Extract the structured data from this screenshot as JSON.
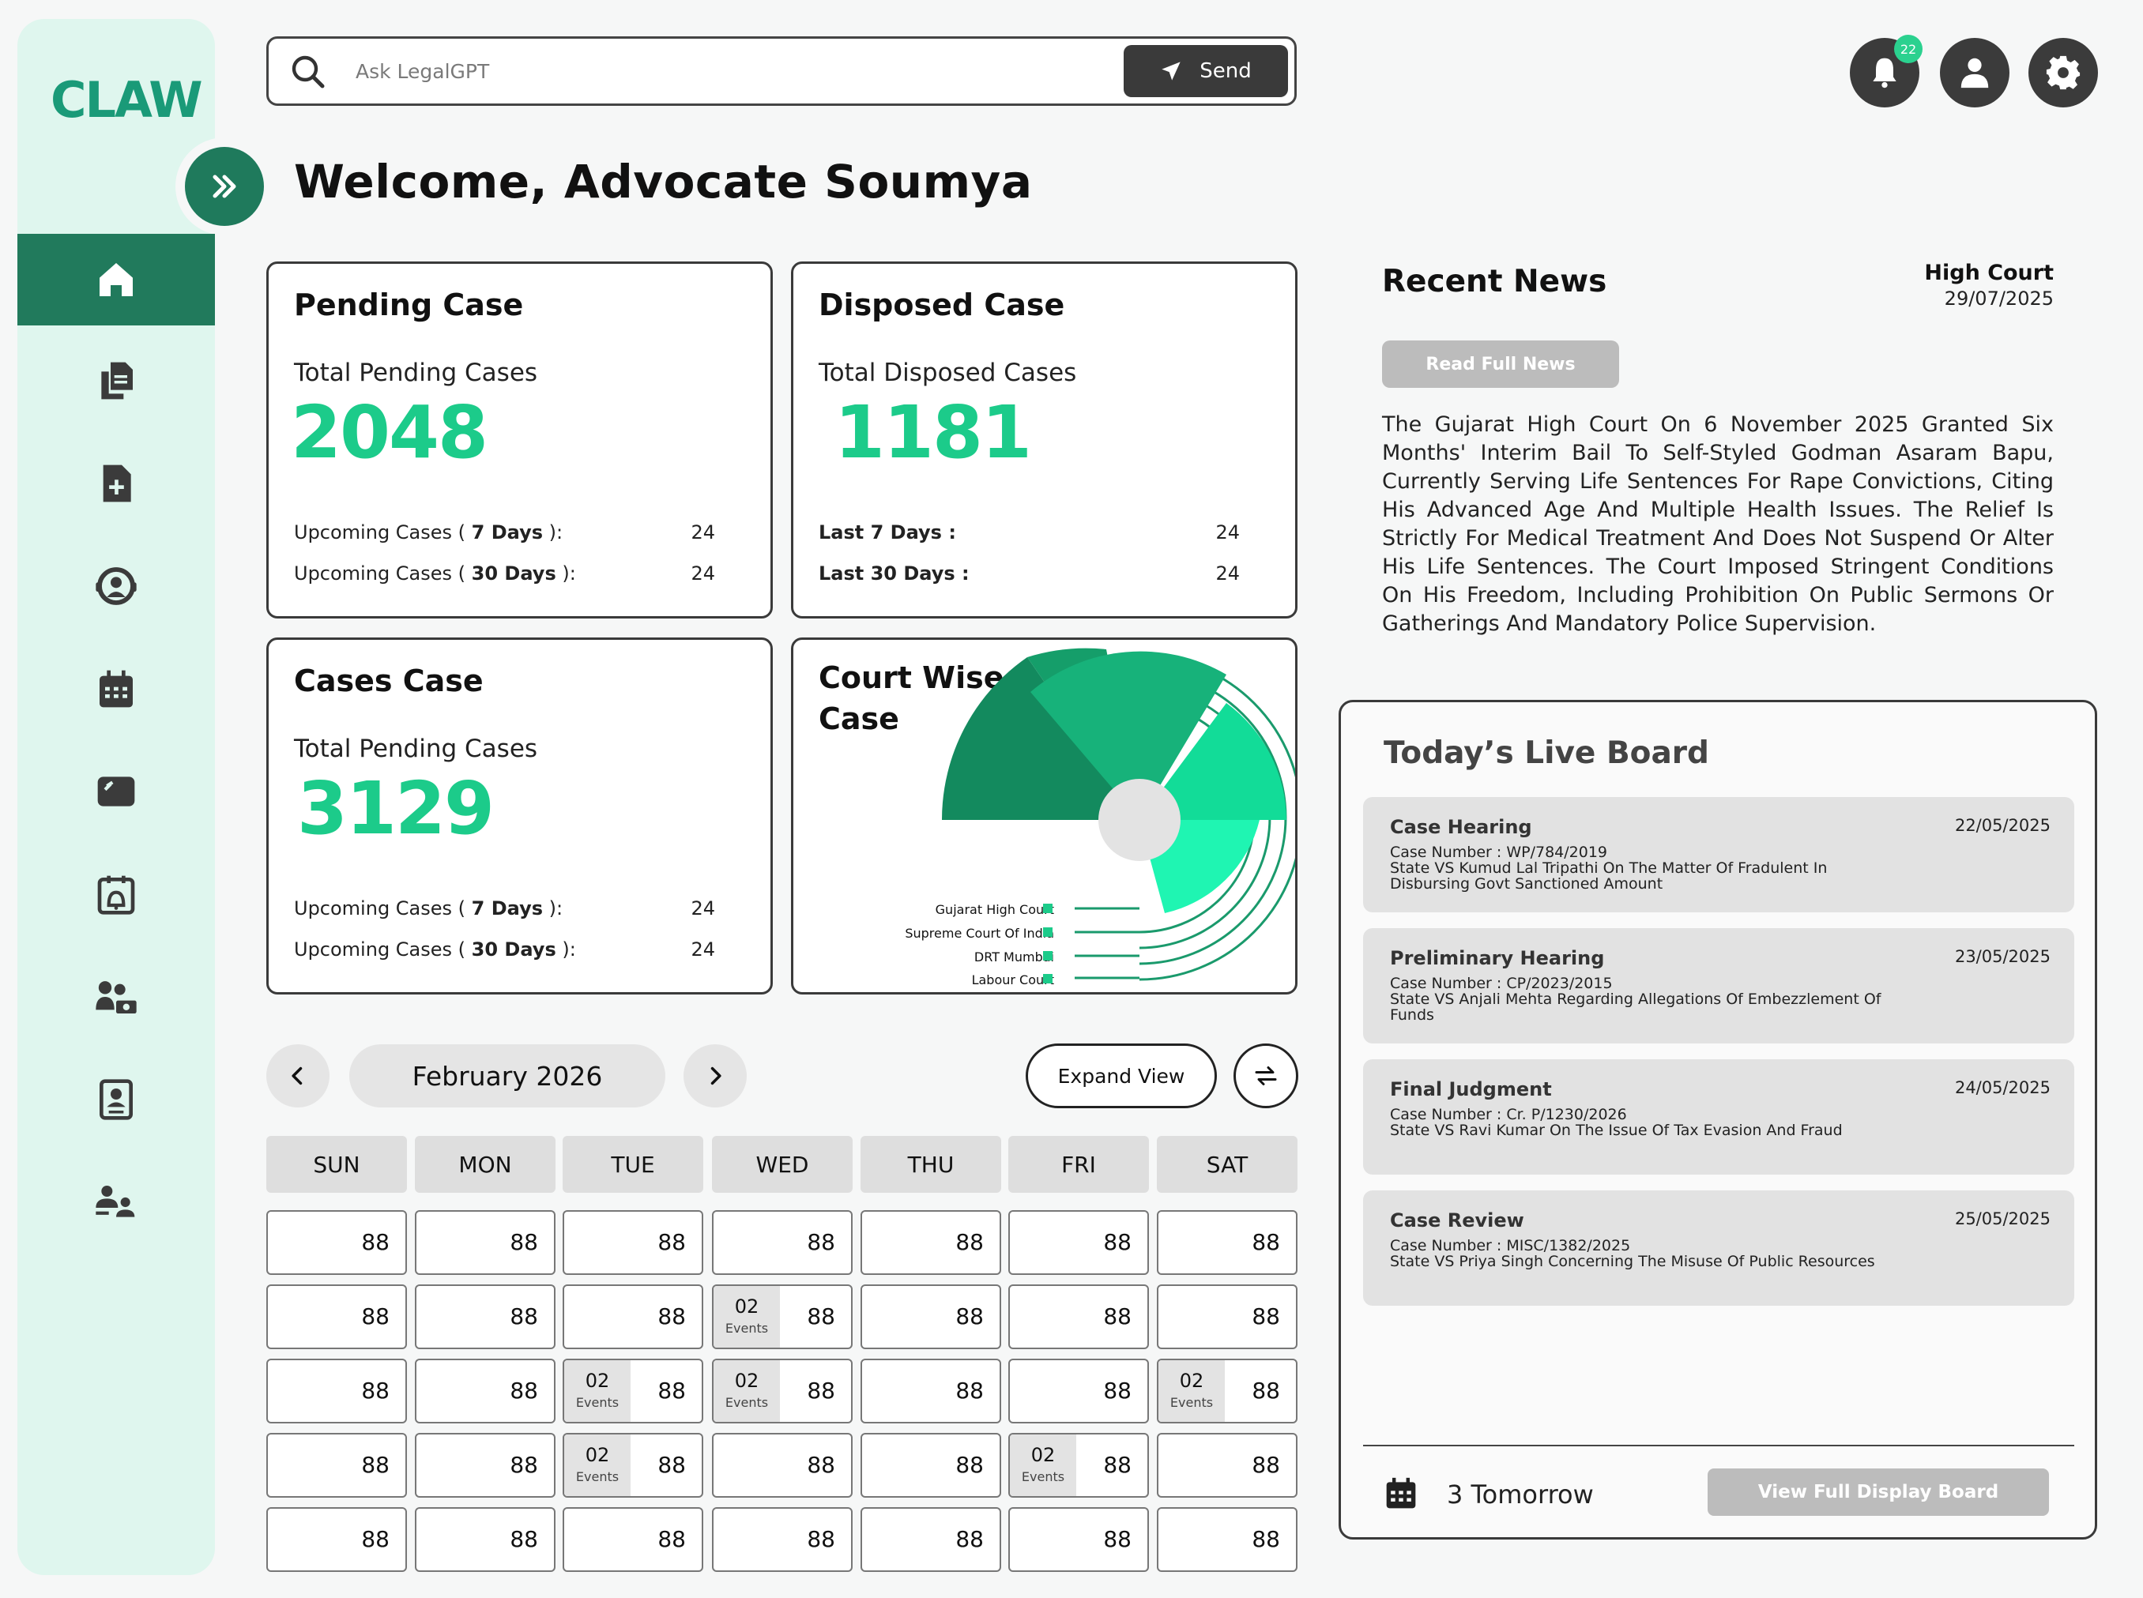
{
  "app": {
    "logo": "CLAW"
  },
  "search": {
    "placeholder": "Ask LegalGPT",
    "send_label": "Send"
  },
  "header": {
    "notification_count": "22",
    "welcome": "Welcome, Advocate Soumya"
  },
  "pending": {
    "title": "Pending Case",
    "subtitle": "Total Pending Cases",
    "total": "2048",
    "row1_label": "Upcoming Cases ( ",
    "row1_bold": "7 Days",
    "row1_end": " ):",
    "row1_value": "24",
    "row2_label": "Upcoming Cases ( ",
    "row2_bold": "30 Days",
    "row2_end": " ):",
    "row2_value": "24"
  },
  "disposed": {
    "title": "Disposed Case",
    "subtitle": "Total Disposed Cases",
    "total": "1181",
    "row1_label": "Last 7 Days :",
    "row1_value": "24",
    "row2_label": "Last 30 Days :",
    "row2_value": "24"
  },
  "cases": {
    "title": "Cases Case",
    "subtitle": "Total Pending Cases",
    "total": "3129",
    "row1_label": "Upcoming Cases ( ",
    "row1_bold": "7 Days",
    "row1_end": " ):",
    "row1_value": "24",
    "row2_label": "Upcoming Cases ( ",
    "row2_bold": "30 Days",
    "row2_end": " ):",
    "row2_value": "24"
  },
  "court_wise": {
    "title_line1": "Court Wise",
    "title_line2": "Case",
    "legend": [
      "Gujarat High Court",
      "Supreme Court Of India",
      "DRT Mumbai",
      "Labour Court"
    ],
    "colors": {
      "dark": "#138a5e",
      "mid": "#17b27a",
      "light": "#12dc98",
      "neon": "#1ff5b2",
      "center": "#e3e3e3",
      "ring": "#1a9a6c"
    }
  },
  "calendar": {
    "month": "February 2026",
    "expand_label": "Expand View",
    "days_of_week": [
      "SUN",
      "MON",
      "TUE",
      "WED",
      "THU",
      "FRI",
      "SAT"
    ],
    "day_label": "88",
    "events_label": "Events",
    "event_count": "02",
    "events": [
      [
        1,
        3
      ],
      [
        2,
        2
      ],
      [
        2,
        3
      ],
      [
        2,
        6
      ],
      [
        3,
        2
      ],
      [
        3,
        5
      ]
    ]
  },
  "news": {
    "title": "Recent News",
    "court": "High Court",
    "date": "29/07/2025",
    "read_label": "Read Full News",
    "body": "The Gujarat High Court On 6 November 2025 Granted Six Months' Interim Bail To Self-Styled Godman Asaram Bapu, Currently Serving Life Sentences For Rape Convictions, Citing His Advanced Age And Multiple Health Issues. The Relief Is Strictly For Medical Treatment And Does Not Suspend Or Alter His Life Sentences. The Court Imposed Stringent Conditions On His Freedom, Including Prohibition On Public Sermons Or Gatherings And Mandatory Police Supervision."
  },
  "live_board": {
    "title": "Today’s Live Board",
    "items": [
      {
        "type": "Case Hearing",
        "date": "22/05/2025",
        "case": "Case Number : WP/784/2019",
        "desc": "State VS Kumud Lal Tripathi On The Matter Of Fradulent In Disbursing Govt Sanctioned Amount"
      },
      {
        "type": "Preliminary Hearing",
        "date": "23/05/2025",
        "case": "Case Number : CP/2023/2015",
        "desc": "State VS Anjali Mehta Regarding Allegations Of Embezzlement Of Funds"
      },
      {
        "type": "Final Judgment",
        "date": "24/05/2025",
        "case": "Case Number : Cr. P/1230/2026",
        "desc": "State VS Ravi Kumar On The Issue Of Tax Evasion And Fraud"
      },
      {
        "type": "Case Review",
        "date": "25/05/2025",
        "case": "Case Number : MISC/1382/2025",
        "desc": "State VS Priya Singh Concerning The Misuse Of Public Resources"
      }
    ],
    "tomorrow": "3 Tomorrow",
    "view_full_label": "View Full Display Board"
  },
  "colors": {
    "accent": "#1ccb8a",
    "sidebar": "#dff6ee",
    "active_nav": "#217a5c",
    "dark": "#3b3b3b"
  }
}
